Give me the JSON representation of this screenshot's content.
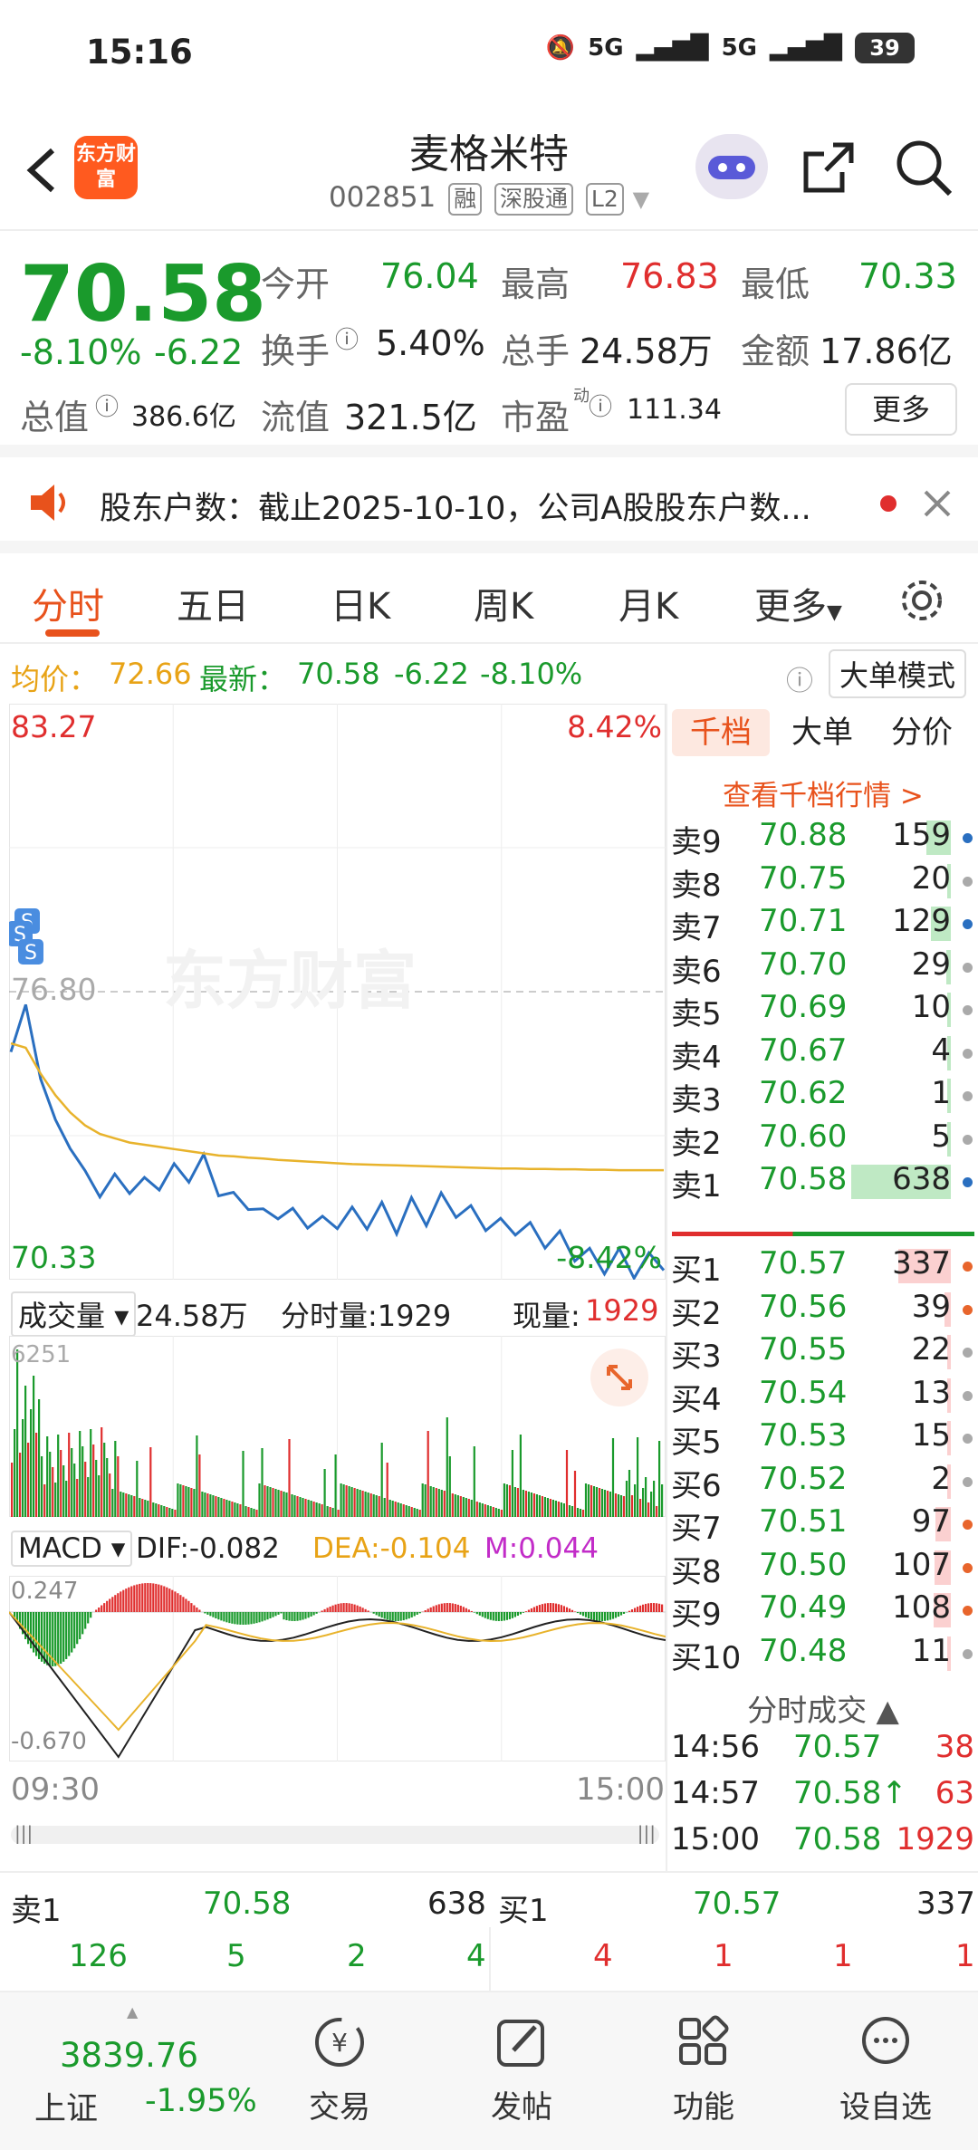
{
  "status": {
    "time": "15:16",
    "network": "5G",
    "battery": "39"
  },
  "header": {
    "logo_text": "东方财富",
    "stock_name": "麦格米特",
    "stock_code": "002851",
    "tags": [
      "融",
      "深股通",
      "L2"
    ]
  },
  "quote": {
    "price": "70.58",
    "pct": "-8.10%",
    "chg": "-6.22",
    "open_label": "今开",
    "open": "76.04",
    "high_label": "最高",
    "high": "76.83",
    "low_label": "最低",
    "low": "70.33",
    "turnover_label": "换手",
    "turnover": "5.40%",
    "volume_label": "总手",
    "volume": "24.58万",
    "amount_label": "金额",
    "amount": "17.86亿",
    "mktcap_label": "总值",
    "mktcap": "386.6亿",
    "float_label": "流值",
    "float": "321.5亿",
    "pe_label": "市盈",
    "pe_sup": "动",
    "pe": "111.34",
    "more": "更多"
  },
  "notice": {
    "text": "股东户数：截止2025-10-10，公司A股股东户数..."
  },
  "tabs": [
    {
      "label": "分时"
    },
    {
      "label": "五日"
    },
    {
      "label": "日K"
    },
    {
      "label": "周K"
    },
    {
      "label": "月K"
    },
    {
      "label": "更多"
    }
  ],
  "avgbar": {
    "avg_label": "均价：",
    "avg": "72.66",
    "last_label": "最新：",
    "last": "70.58",
    "chg": "-6.22",
    "pct": "-8.10%",
    "mode_button": "大单模式"
  },
  "chart_data": {
    "type": "line",
    "title": "",
    "y_max_label": "83.27",
    "y_min_label": "70.33",
    "pct_max": "8.42%",
    "pct_min": "-8.42%",
    "prev_close": "76.80",
    "x_start": "09:30",
    "x_end": "15:00",
    "series": [
      {
        "name": "",
        "color": "#2a6fc0",
        "values": [
          75.4,
          76.5,
          74.8,
          73.8,
          73.2,
          72.6,
          72.1,
          72.5,
          72.2,
          72.4,
          72.3,
          72.7,
          72.5,
          72.9,
          72.2,
          72.0,
          71.9,
          71.6,
          71.7,
          71.6,
          71.5,
          71.4,
          71.5,
          71.6,
          71.5,
          71.7,
          71.4,
          71.8,
          71.6,
          71.9,
          71.8,
          71.6,
          71.5,
          71.3,
          71.4,
          71.2,
          71.1,
          71.0,
          70.8,
          70.6,
          70.5,
          70.6,
          70.4,
          70.5,
          70.58
        ]
      },
      {
        "name": "",
        "color": "#e8b32c",
        "values": [
          75.6,
          75.5,
          74.9,
          74.4,
          74.0,
          73.7,
          73.5,
          73.4,
          73.3,
          73.25,
          73.2,
          73.15,
          73.1,
          73.05,
          73.0,
          72.98,
          72.95,
          72.93,
          72.9,
          72.88,
          72.86,
          72.84,
          72.82,
          72.8,
          72.79,
          72.78,
          72.77,
          72.76,
          72.75,
          72.74,
          72.73,
          72.72,
          72.71,
          72.7,
          72.7,
          72.69,
          72.69,
          72.68,
          72.68,
          72.67,
          72.67,
          72.66,
          72.66,
          72.66,
          72.66
        ]
      }
    ]
  },
  "vol": {
    "label": "成交量",
    "total": "24.58万",
    "tick_label": "分时量:1929",
    "now_label": "现量:",
    "now": "1929",
    "max": "6251"
  },
  "macd": {
    "label": "MACD",
    "dif": "DIF:-0.082",
    "dea": "DEA:-0.104",
    "m": "M:0.044",
    "top": "0.247",
    "bottom": "-0.670"
  },
  "book": {
    "tabs": [
      "千档",
      "大单",
      "分价"
    ],
    "link": "查看千档行情 >",
    "asks": [
      {
        "label": "卖9",
        "price": "70.88",
        "qty": "159",
        "dot": "#2a6fc0"
      },
      {
        "label": "卖8",
        "price": "70.75",
        "qty": "20",
        "dot": "#aaa"
      },
      {
        "label": "卖7",
        "price": "70.71",
        "qty": "129",
        "dot": "#2a6fc0"
      },
      {
        "label": "卖6",
        "price": "70.70",
        "qty": "29",
        "dot": "#aaa"
      },
      {
        "label": "卖5",
        "price": "70.69",
        "qty": "10",
        "dot": "#aaa"
      },
      {
        "label": "卖4",
        "price": "70.67",
        "qty": "4",
        "dot": "#aaa"
      },
      {
        "label": "卖3",
        "price": "70.62",
        "qty": "1",
        "dot": "#aaa"
      },
      {
        "label": "卖2",
        "price": "70.60",
        "qty": "5",
        "dot": "#aaa"
      },
      {
        "label": "卖1",
        "price": "70.58",
        "qty": "638",
        "dot": "#2a6fc0"
      }
    ],
    "bids": [
      {
        "label": "买1",
        "price": "70.57",
        "qty": "337",
        "dot": "#e8652c"
      },
      {
        "label": "买2",
        "price": "70.56",
        "qty": "39",
        "dot": "#e8652c"
      },
      {
        "label": "买3",
        "price": "70.55",
        "qty": "22",
        "dot": "#aaa"
      },
      {
        "label": "买4",
        "price": "70.54",
        "qty": "13",
        "dot": "#aaa"
      },
      {
        "label": "买5",
        "price": "70.53",
        "qty": "15",
        "dot": "#aaa"
      },
      {
        "label": "买6",
        "price": "70.52",
        "qty": "2",
        "dot": "#aaa"
      },
      {
        "label": "买7",
        "price": "70.51",
        "qty": "97",
        "dot": "#e8652c"
      },
      {
        "label": "买8",
        "price": "70.50",
        "qty": "107",
        "dot": "#e8652c"
      },
      {
        "label": "买9",
        "price": "70.49",
        "qty": "108",
        "dot": "#e8652c"
      },
      {
        "label": "买10",
        "price": "70.48",
        "qty": "11",
        "dot": "#aaa"
      }
    ],
    "ticks_title": "分时成交",
    "ticks": [
      {
        "time": "14:56",
        "price": "70.57",
        "qty": "38"
      },
      {
        "time": "14:57",
        "price": "70.58↑",
        "qty": "63"
      },
      {
        "time": "15:00",
        "price": "70.58",
        "qty": "1929"
      }
    ]
  },
  "summary": {
    "sell_label": "卖1",
    "sell_price": "70.58",
    "sell_qty": "638",
    "buy_label": "买1",
    "buy_price": "70.57",
    "buy_qty": "337",
    "sell_nums": [
      "126",
      "5",
      "2",
      "4"
    ],
    "buy_nums": [
      "4",
      "1",
      "1",
      "1"
    ]
  },
  "nav": {
    "index_value": "3839.76",
    "index_name": "上证",
    "index_pct": "-1.95%",
    "items": [
      "交易",
      "发帖",
      "功能",
      "设自选"
    ]
  }
}
